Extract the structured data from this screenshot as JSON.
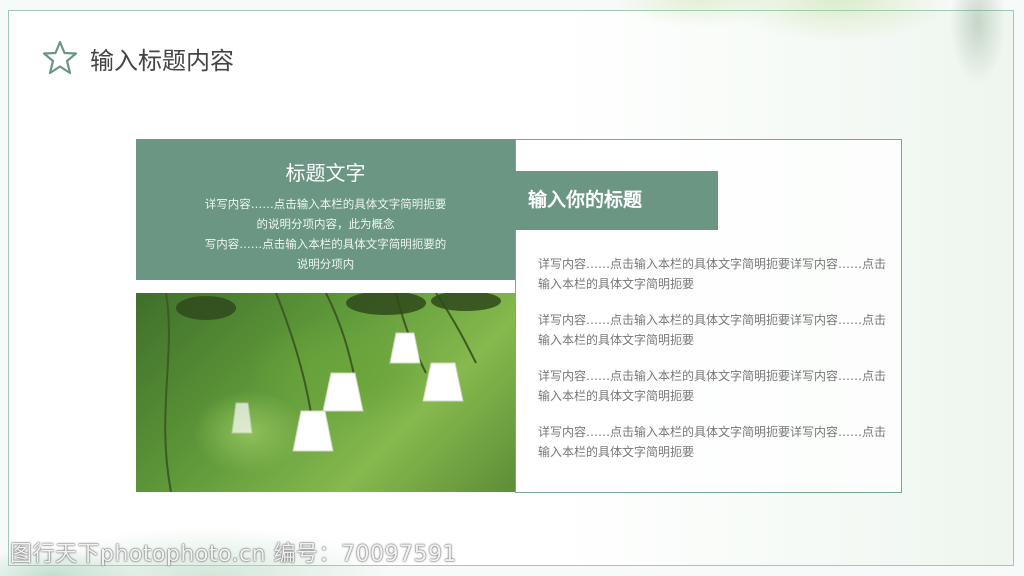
{
  "header": {
    "title": "输入标题内容"
  },
  "left_card": {
    "title": "标题文字",
    "lines": [
      "详写内容……点击输入本栏的具体文字简明扼要",
      "的说明分项内容，此为概念",
      "写内容……点击输入本栏的具体文字简明扼要的",
      "说明分项内"
    ]
  },
  "right_card": {
    "title": "输入你的标题",
    "paragraphs": [
      "详写内容……点击输入本栏的具体文字简明扼要详写内容……点击输入本栏的具体文字简明扼要",
      "详写内容……点击输入本栏的具体文字简明扼要详写内容……点击输入本栏的具体文字简明扼要",
      "详写内容……点击输入本栏的具体文字简明扼要详写内容……点击输入本栏的具体文字简明扼要",
      "详写内容……点击输入本栏的具体文字简明扼要详写内容……点击输入本栏的具体文字简明扼要"
    ]
  },
  "watermark": "图行天下photophoto.cn 编号：70097591",
  "colors": {
    "accent": "#6a9683",
    "border": "#9fc8b6"
  }
}
